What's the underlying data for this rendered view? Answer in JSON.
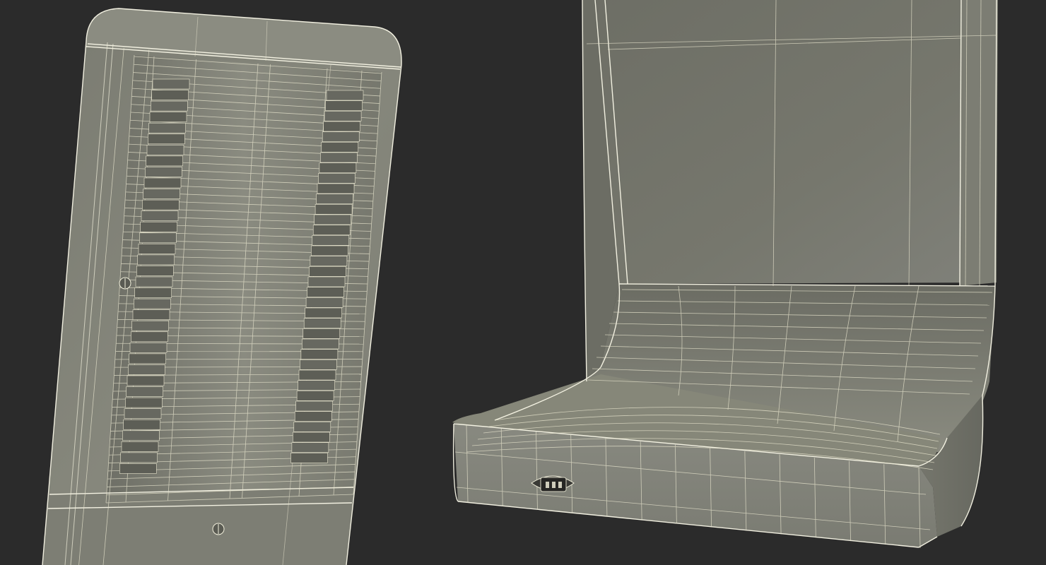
{
  "scene": {
    "background_color": "#2b2b2b",
    "surface_color": "#85867b",
    "surface_shadow_color": "#5f6058",
    "wire_color": "#f2f0dc",
    "views": [
      {
        "name": "back-view",
        "features": [
          "ventilation-grille",
          "screw",
          "base-screw"
        ]
      },
      {
        "name": "side-view",
        "features": [
          "backrest",
          "curved-seat",
          "base",
          "power-inlet-socket"
        ]
      }
    ]
  }
}
